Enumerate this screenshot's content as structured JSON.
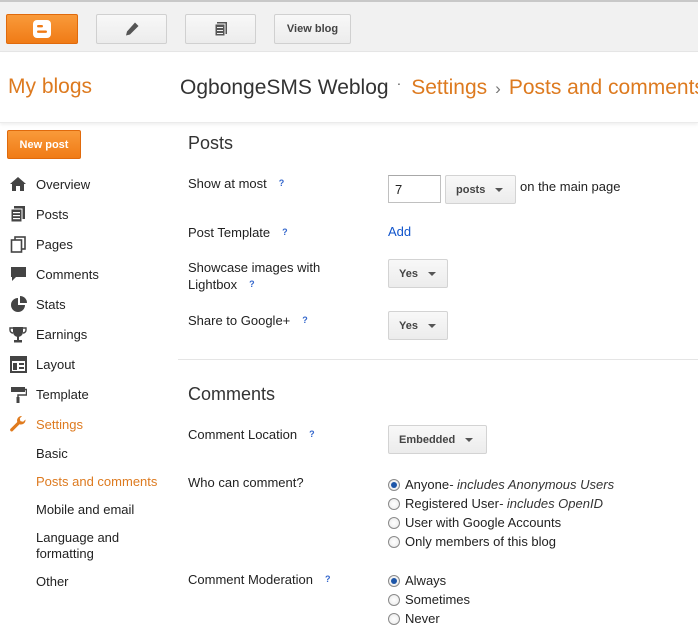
{
  "toolbar": {
    "view_blog_label": "View blog"
  },
  "header": {
    "my_blogs": "My blogs",
    "blog_name": "OgbongeSMS Weblog",
    "dot": "·",
    "crumb_settings": "Settings",
    "sep": "›",
    "crumb_current": "Posts and comments"
  },
  "sidebar": {
    "new_post_label": "New post",
    "items": [
      {
        "label": "Overview",
        "icon": "home-icon"
      },
      {
        "label": "Posts",
        "icon": "posts-icon"
      },
      {
        "label": "Pages",
        "icon": "pages-icon"
      },
      {
        "label": "Comments",
        "icon": "comments-icon"
      },
      {
        "label": "Stats",
        "icon": "stats-icon"
      },
      {
        "label": "Earnings",
        "icon": "trophy-icon"
      },
      {
        "label": "Layout",
        "icon": "layout-icon"
      },
      {
        "label": "Template",
        "icon": "paint-roller-icon"
      },
      {
        "label": "Settings",
        "icon": "wrench-icon"
      }
    ],
    "settings_sub": [
      "Basic",
      "Posts and comments",
      "Mobile and email",
      "Language and formatting",
      "Other"
    ]
  },
  "posts": {
    "title": "Posts",
    "show_at_most_label": "Show at most",
    "show_at_most_value": "7",
    "unit_select": "posts",
    "unit_suffix": "on the main page",
    "post_template_label": "Post Template",
    "post_template_link": "Add",
    "lightbox_label": "Showcase images with Lightbox",
    "lightbox_value": "Yes",
    "share_google_label": "Share to Google+",
    "share_google_value": "Yes",
    "help_mark": "?"
  },
  "comments": {
    "title": "Comments",
    "location_label": "Comment Location",
    "location_value": "Embedded",
    "who_label": "Who can comment?",
    "who_options": [
      {
        "main": "Anyone",
        "note": " - includes Anonymous Users",
        "selected": true
      },
      {
        "main": "Registered User",
        "note": " - includes OpenID",
        "selected": false
      },
      {
        "main": "User with Google Accounts",
        "note": "",
        "selected": false
      },
      {
        "main": "Only members of this blog",
        "note": "",
        "selected": false
      }
    ],
    "moderation_label": "Comment Moderation",
    "moderation_options": [
      {
        "main": "Always",
        "selected": true
      },
      {
        "main": "Sometimes",
        "selected": false
      },
      {
        "main": "Never",
        "selected": false
      }
    ]
  },
  "colors": {
    "accent": "#dd7a1f",
    "brand_orange": "#f07b16",
    "link": "#1155cc"
  }
}
